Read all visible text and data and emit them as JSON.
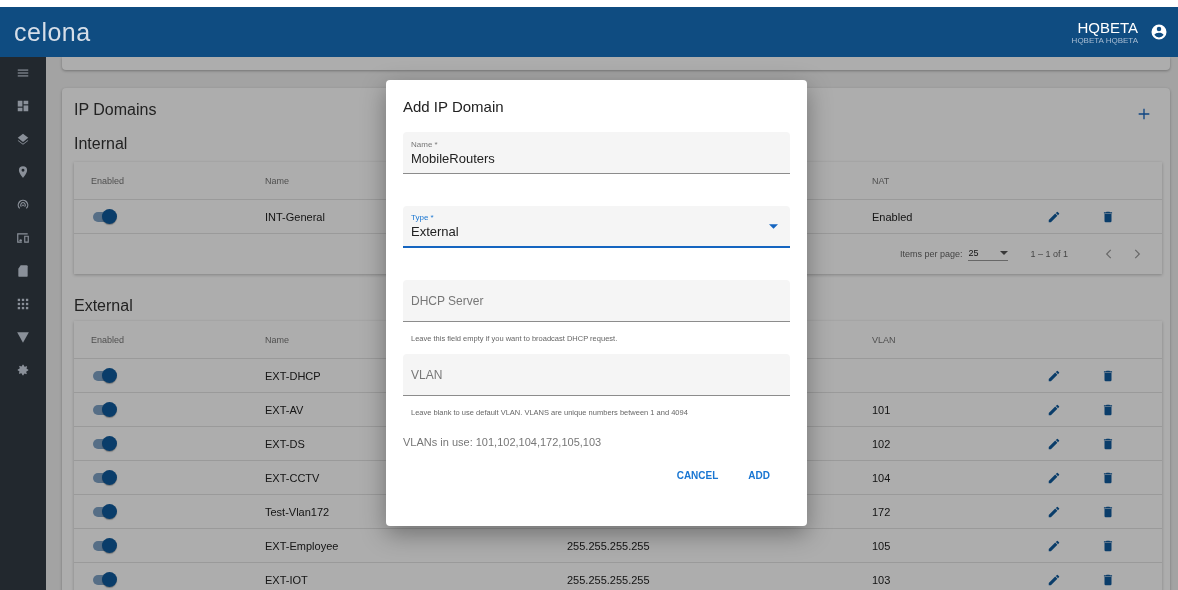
{
  "header": {
    "logo": "celona",
    "user_name": "HQBETA",
    "user_subtitle": "HQBETA HQBETA"
  },
  "card": {
    "title": "IP Domains"
  },
  "internal": {
    "title": "Internal",
    "columns": [
      "Enabled",
      "Name",
      "NAT"
    ],
    "rows": [
      {
        "enabled": true,
        "name": "INT-General",
        "nat": "Enabled"
      }
    ],
    "paginator": {
      "label": "Items per page:",
      "page_size": "25",
      "range": "1 – 1 of 1"
    }
  },
  "external": {
    "title": "External",
    "columns": [
      "Enabled",
      "Name",
      "VLAN"
    ],
    "rows": [
      {
        "enabled": true,
        "name": "EXT-DHCP"
      },
      {
        "enabled": true,
        "name": "EXT-AV",
        "vlan": "101"
      },
      {
        "enabled": true,
        "name": "EXT-DS",
        "vlan": "102"
      },
      {
        "enabled": true,
        "name": "EXT-CCTV",
        "vlan": "104"
      },
      {
        "enabled": true,
        "name": "Test-Vlan172",
        "vlan": "172"
      },
      {
        "enabled": true,
        "name": "EXT-Employee",
        "column_3": "255.255.255.255",
        "vlan": "105"
      },
      {
        "enabled": true,
        "name": "EXT-IOT",
        "column_3": "255.255.255.255",
        "vlan": "103"
      }
    ]
  },
  "dialog": {
    "title": "Add IP Domain",
    "fields": [
      {
        "kind": "text",
        "label": "Name *",
        "value": "MobileRouters",
        "focused": false
      },
      {
        "kind": "select",
        "label": "Type *",
        "value": "External",
        "focused": true
      },
      {
        "kind": "text",
        "placeholder": "DHCP Server",
        "hint": "Leave this field empty if you want to broadcast DHCP request.",
        "focused": false
      },
      {
        "kind": "text",
        "placeholder": "VLAN",
        "hint": "Leave blank to use default VLAN. VLANS are unique numbers between 1 and 4094",
        "focused": false
      }
    ],
    "vlans_in_use": "VLANs in use: 101,102,104,172,105,103",
    "buttons": [
      "CANCEL",
      "ADD"
    ]
  }
}
